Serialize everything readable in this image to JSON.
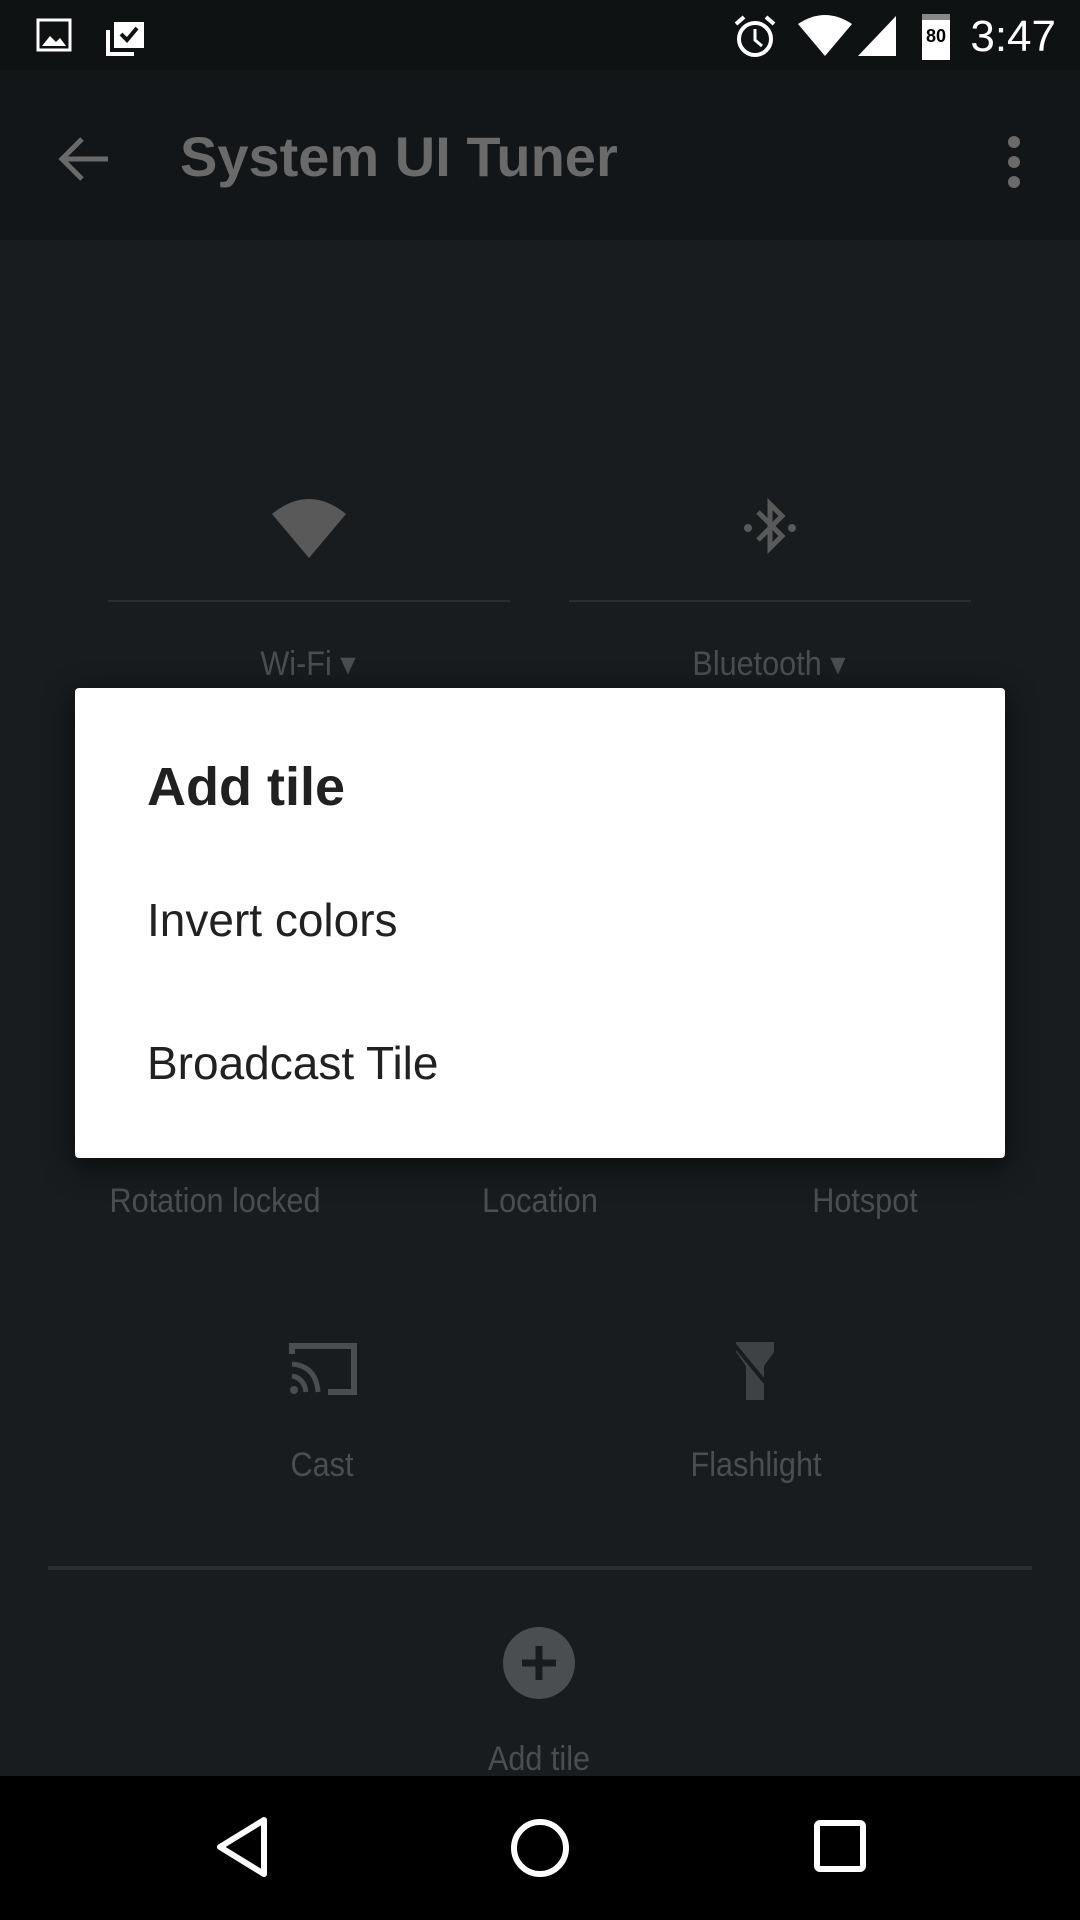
{
  "status_bar": {
    "time": "3:47",
    "battery": "80",
    "icons": [
      "image-icon",
      "task-check-icon",
      "alarm-icon",
      "wifi-icon",
      "signal-icon",
      "battery-icon"
    ]
  },
  "app_bar": {
    "title": "System UI Tuner",
    "icons": [
      "back-arrow-icon",
      "more-vert-icon"
    ]
  },
  "tiles": {
    "wifi": "Wi-Fi",
    "bluetooth": "Bluetooth",
    "rotation": "Rotation locked",
    "location": "Location",
    "hotspot": "Hotspot",
    "cast": "Cast",
    "flashlight": "Flashlight",
    "add_tile": "Add tile"
  },
  "dialog": {
    "title": "Add tile",
    "items": [
      {
        "label": "Invert colors"
      },
      {
        "label": "Broadcast Tile"
      }
    ]
  },
  "nav_bar": {
    "icons": [
      "back-icon",
      "home-icon",
      "recents-icon"
    ]
  }
}
